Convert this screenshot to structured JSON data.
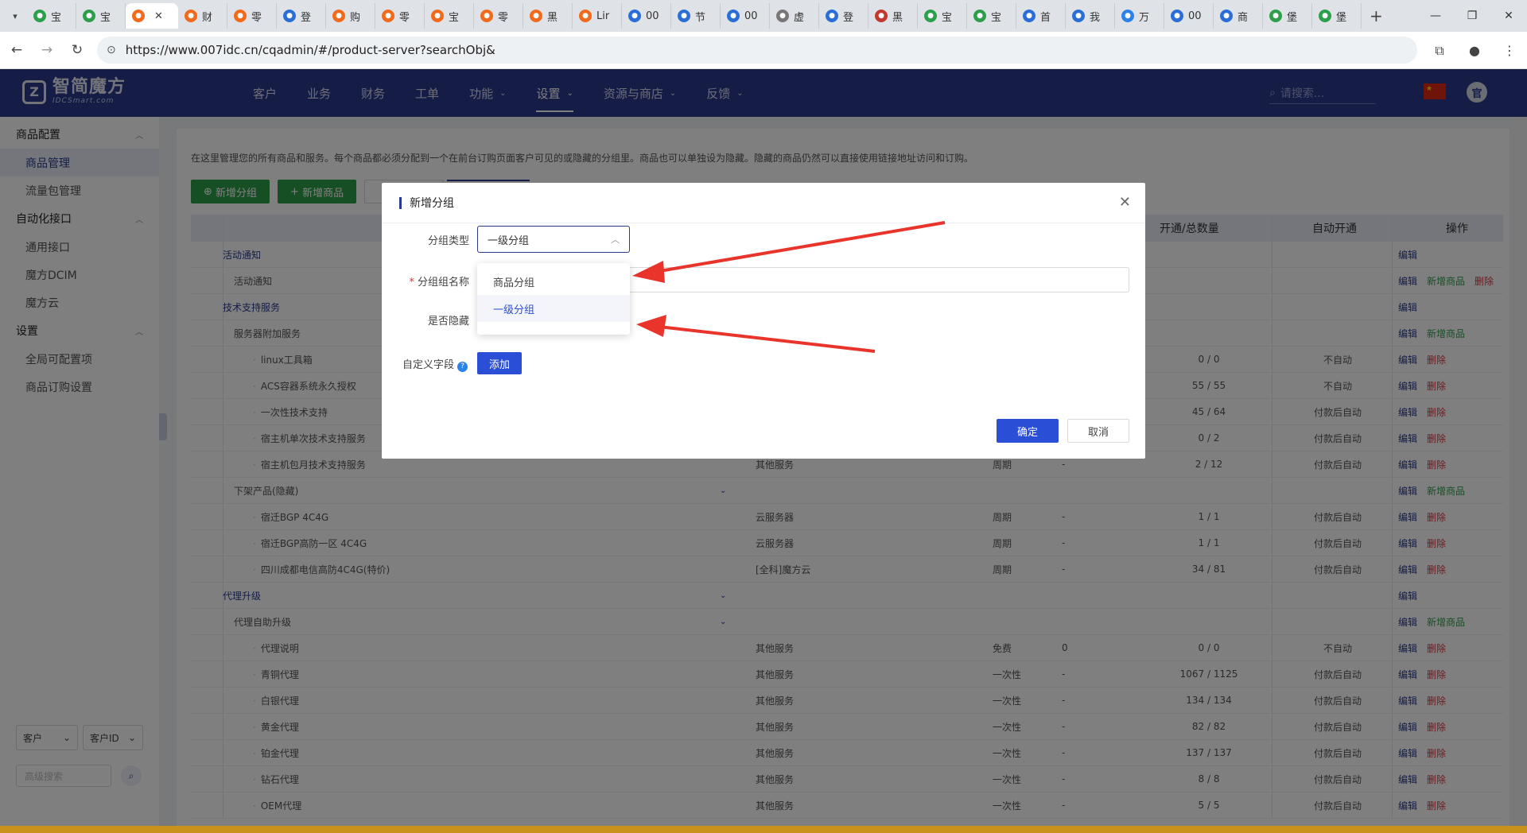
{
  "browser": {
    "tabs": [
      {
        "label": "宝",
        "color": "#2e9f49"
      },
      {
        "label": "宝",
        "color": "#2e9f49"
      },
      {
        "label": "",
        "color": "#f26b1d",
        "active": true
      },
      {
        "label": "财",
        "color": "#f26b1d"
      },
      {
        "label": "零",
        "color": "#f26b1d"
      },
      {
        "label": "登",
        "color": "#2b6fd6"
      },
      {
        "label": "购",
        "color": "#f26b1d"
      },
      {
        "label": "零",
        "color": "#f26b1d"
      },
      {
        "label": "宝",
        "color": "#f26b1d"
      },
      {
        "label": "零",
        "color": "#f26b1d"
      },
      {
        "label": "黑",
        "color": "#f26b1d"
      },
      {
        "label": "Lir",
        "color": "#f26b1d"
      },
      {
        "label": "00",
        "color": "#2b6fd6"
      },
      {
        "label": "节",
        "color": "#2b6fd6"
      },
      {
        "label": "00",
        "color": "#2b6fd6"
      },
      {
        "label": "虚",
        "color": "#777777"
      },
      {
        "label": "登",
        "color": "#2b6fd6"
      },
      {
        "label": "黑",
        "color": "#c0392b"
      },
      {
        "label": "宝",
        "color": "#2e9f49"
      },
      {
        "label": "宝",
        "color": "#2e9f49"
      },
      {
        "label": "首",
        "color": "#2b6fd6"
      },
      {
        "label": "我",
        "color": "#2b6fd6"
      },
      {
        "label": "万",
        "color": "#2b82e8"
      },
      {
        "label": "00",
        "color": "#2b6fd6"
      },
      {
        "label": "商",
        "color": "#2b6fd6"
      },
      {
        "label": "堡",
        "color": "#2e9f49"
      },
      {
        "label": "堡",
        "color": "#2e9f49"
      }
    ],
    "url": "https://www.007idc.cn/cqadmin/#/product-server?searchObj&"
  },
  "header": {
    "logo_cn": "智简魔方",
    "logo_en": "IDCSmart.com",
    "nav": [
      {
        "label": "客户",
        "dropdown": false
      },
      {
        "label": "业务",
        "dropdown": false
      },
      {
        "label": "财务",
        "dropdown": false
      },
      {
        "label": "工单",
        "dropdown": false
      },
      {
        "label": "功能",
        "dropdown": true
      },
      {
        "label": "设置",
        "dropdown": true,
        "active": true
      },
      {
        "label": "资源与商店",
        "dropdown": true
      },
      {
        "label": "反馈",
        "dropdown": true
      }
    ],
    "search_placeholder": "请搜索..."
  },
  "sidebar": {
    "groups": [
      {
        "title": "商品配置",
        "items": [
          {
            "label": "商品管理",
            "active": true
          },
          {
            "label": "流量包管理"
          }
        ]
      },
      {
        "title": "自动化接口",
        "items": [
          {
            "label": "通用接口"
          },
          {
            "label": "魔方DCIM"
          },
          {
            "label": "魔方云"
          }
        ]
      },
      {
        "title": "设置",
        "items": [
          {
            "label": "全局可配置项"
          },
          {
            "label": "商品订购设置"
          }
        ]
      }
    ],
    "select_left": "客户",
    "select_right": "客户ID",
    "adv_search": "高级搜索"
  },
  "content": {
    "description": "在这里管理您的所有商品和服务。每个商品都必须分配到一个在前台订购页面客户可见的或隐藏的分组里。商品也可以单独设为隐藏。隐藏的商品仍然可以直接使用链接地址访问和订购。",
    "btn_new_group": "新增分组",
    "btn_new_product": "新增商品",
    "columns": {
      "num": "开通/总数量",
      "auto": "自动开通",
      "op": "操作"
    },
    "ops": {
      "edit": "编辑",
      "add": "新增商品",
      "del": "删除"
    },
    "rows": [
      {
        "level": 0,
        "name": "活动通知",
        "link": true,
        "ops": [
          "edit"
        ]
      },
      {
        "level": 1,
        "name": "活动通知",
        "ops": [
          "edit",
          "add",
          "del"
        ]
      },
      {
        "level": 0,
        "name": "技术支持服务",
        "link": true,
        "ops": [
          "edit"
        ]
      },
      {
        "level": 1,
        "name": "服务器附加服务",
        "ops": [
          "edit",
          "add"
        ]
      },
      {
        "level": 2,
        "name": "linux工具箱",
        "type": "",
        "cycle": "",
        "price": "",
        "num": "0 / 0",
        "auto": "不自动",
        "ops": [
          "edit",
          "del"
        ]
      },
      {
        "level": 2,
        "name": "ACS容器系统永久授权",
        "type": "",
        "cycle": "",
        "price": "",
        "num": "55 / 55",
        "auto": "不自动",
        "ops": [
          "edit",
          "del"
        ]
      },
      {
        "level": 2,
        "name": "一次性技术支持",
        "type": "",
        "cycle": "",
        "price": "",
        "num": "45 / 64",
        "auto": "付款后自动",
        "ops": [
          "edit",
          "del"
        ]
      },
      {
        "level": 2,
        "name": "宿主机单次技术支持服务",
        "type": "",
        "cycle": "",
        "price": "",
        "num": "0 / 2",
        "auto": "付款后自动",
        "ops": [
          "edit",
          "del"
        ]
      },
      {
        "level": 2,
        "name": "宿主机包月技术支持服务",
        "type": "其他服务",
        "cycle": "周期",
        "price": "-",
        "num": "2 / 12",
        "auto": "付款后自动",
        "ops": [
          "edit",
          "del"
        ]
      },
      {
        "level": 1,
        "name": "下架产品(隐藏)",
        "chev": true,
        "ops": [
          "edit",
          "add"
        ]
      },
      {
        "level": 2,
        "name": "宿迁BGP 4C4G",
        "type": "云服务器",
        "cycle": "周期",
        "price": "-",
        "num": "1 / 1",
        "auto": "付款后自动",
        "ops": [
          "edit",
          "del"
        ]
      },
      {
        "level": 2,
        "name": "宿迁BGP高防一区 4C4G",
        "type": "云服务器",
        "cycle": "周期",
        "price": "-",
        "num": "1 / 1",
        "auto": "付款后自动",
        "ops": [
          "edit",
          "del"
        ]
      },
      {
        "level": 2,
        "name": "四川成都电信高防4C4G(特价)",
        "type": "[全科]魔方云",
        "cycle": "周期",
        "price": "-",
        "num": "34 / 81",
        "auto": "付款后自动",
        "ops": [
          "edit",
          "del"
        ]
      },
      {
        "level": 0,
        "name": "代理升级",
        "link": true,
        "chev": true,
        "ops": [
          "edit"
        ]
      },
      {
        "level": 1,
        "name": "代理自助升级",
        "chev": true,
        "ops": [
          "edit",
          "add"
        ]
      },
      {
        "level": 2,
        "name": "代理说明",
        "type": "其他服务",
        "cycle": "免费",
        "price": "0",
        "num": "0 / 0",
        "auto": "不自动",
        "ops": [
          "edit",
          "del"
        ]
      },
      {
        "level": 2,
        "name": "青铜代理",
        "type": "其他服务",
        "cycle": "一次性",
        "price": "-",
        "num": "1067 / 1125",
        "auto": "付款后自动",
        "ops": [
          "edit",
          "del"
        ]
      },
      {
        "level": 2,
        "name": "白银代理",
        "type": "其他服务",
        "cycle": "一次性",
        "price": "-",
        "num": "134 / 134",
        "auto": "付款后自动",
        "ops": [
          "edit",
          "del"
        ]
      },
      {
        "level": 2,
        "name": "黄金代理",
        "type": "其他服务",
        "cycle": "一次性",
        "price": "-",
        "num": "82 / 82",
        "auto": "付款后自动",
        "ops": [
          "edit",
          "del"
        ]
      },
      {
        "level": 2,
        "name": "铂金代理",
        "type": "其他服务",
        "cycle": "一次性",
        "price": "-",
        "num": "137 / 137",
        "auto": "付款后自动",
        "ops": [
          "edit",
          "del"
        ]
      },
      {
        "level": 2,
        "name": "钻石代理",
        "type": "其他服务",
        "cycle": "一次性",
        "price": "-",
        "num": "8 / 8",
        "auto": "付款后自动",
        "ops": [
          "edit",
          "del"
        ]
      },
      {
        "level": 2,
        "name": "OEM代理",
        "type": "其他服务",
        "cycle": "一次性",
        "price": "-",
        "num": "5 / 5",
        "auto": "付款后自动",
        "ops": [
          "edit",
          "del"
        ]
      }
    ]
  },
  "modal": {
    "title": "新增分组",
    "type_label": "分组类型",
    "type_value": "一级分组",
    "name_label": "分组组名称",
    "hidden_label": "是否隐藏",
    "custom_label": "自定义字段",
    "add_btn": "添加",
    "options": [
      {
        "label": "商品分组"
      },
      {
        "label": "一级分组",
        "selected": true
      }
    ],
    "ok": "确定",
    "cancel": "取消"
  },
  "colors": {
    "brand": "#2b3a8f",
    "primary_btn": "#2b4ed6",
    "green": "#2e9f49",
    "danger": "#e0343f",
    "annotation_arrow": "#e8342b"
  }
}
